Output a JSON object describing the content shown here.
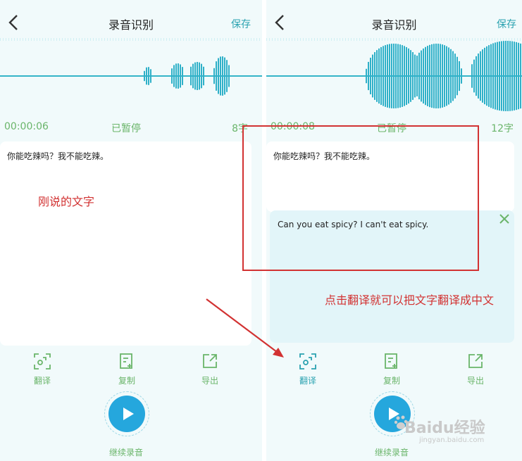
{
  "colors": {
    "accent": "#2aa2b0",
    "green": "#6ab56a",
    "play": "#25a7dd",
    "annotation": "#d23232"
  },
  "left": {
    "title": "录音识别",
    "save_label": "保存",
    "time": "00:00:06",
    "status": "已暂停",
    "char_count": "8字",
    "transcript": "你能吃辣吗？我不能吃辣。",
    "annotation": "刚说的文字",
    "actions": [
      {
        "label": "翻译",
        "icon": "translate-icon"
      },
      {
        "label": "复制",
        "icon": "copy-icon"
      },
      {
        "label": "导出",
        "icon": "export-icon"
      }
    ],
    "continue_label": "继续录音"
  },
  "right": {
    "title": "录音识别",
    "save_label": "保存",
    "time": "00:00:08",
    "status": "已暂停",
    "char_count": "12字",
    "transcript": "你能吃辣吗？我不能吃辣。",
    "translation": "Can you eat spicy? I can't eat spicy.",
    "annotation": "点击翻译就可以把文字翻译成中文",
    "actions": [
      {
        "label": "翻译",
        "icon": "translate-icon"
      },
      {
        "label": "复制",
        "icon": "copy-icon"
      },
      {
        "label": "导出",
        "icon": "export-icon"
      }
    ],
    "continue_label": "继续录音"
  },
  "watermark": {
    "text": "Baidu经验",
    "sub": "jingyan.baidu.com"
  }
}
